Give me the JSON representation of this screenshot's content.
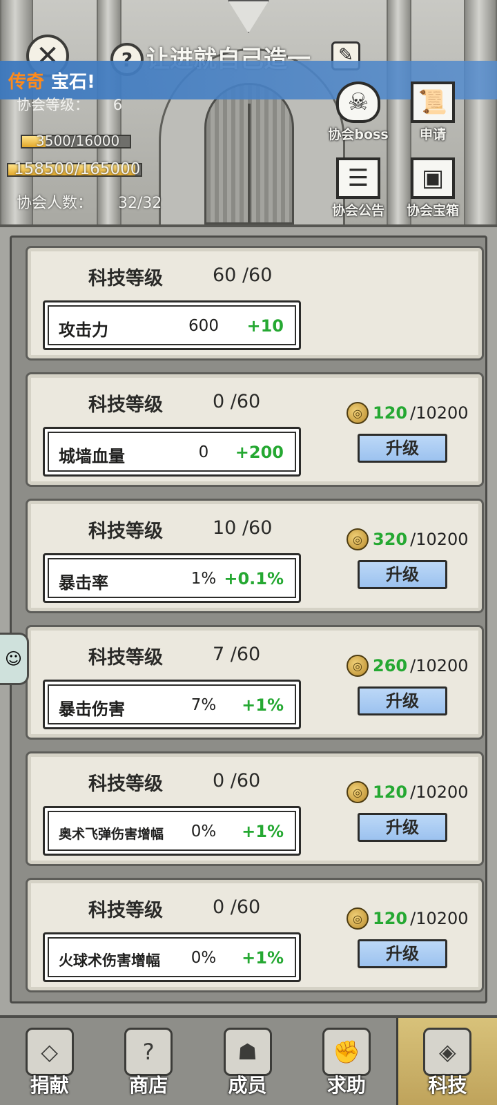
{
  "header": {
    "guild_name": "让进就自己造一",
    "banner": {
      "rarity": "传奇",
      "text": "宝石!"
    },
    "guild_level_label": "协会等级：",
    "guild_level_value": "6",
    "exp_bar": {
      "label": "3500/16000",
      "fraction": 0.22
    },
    "fund_bar": {
      "label": "158500/165000",
      "fraction": 0.96
    },
    "members_label": "协会人数：",
    "members_value": "32/32",
    "buttons": {
      "boss": "协会boss",
      "apply": "申请",
      "notice": "协会公告",
      "chest": "协会宝箱"
    }
  },
  "tech_level_label": "科技等级",
  "upgrade_label": "升级",
  "cards": [
    {
      "level": "60 /60",
      "stat": "攻击力",
      "current": "600",
      "increment": "+10",
      "cost_have": "",
      "cost_need": ""
    },
    {
      "level": "0 /60",
      "stat": "城墙血量",
      "current": "0",
      "increment": "+200",
      "cost_have": "120",
      "cost_need": "/10200"
    },
    {
      "level": "10 /60",
      "stat": "暴击率",
      "current": "1%",
      "increment": "+0.1%",
      "cost_have": "320",
      "cost_need": "/10200"
    },
    {
      "level": "7 /60",
      "stat": "暴击伤害",
      "current": "7%",
      "increment": "+1%",
      "cost_have": "260",
      "cost_need": "/10200"
    },
    {
      "level": "0 /60",
      "stat": "奥术飞弹伤害增幅",
      "current": "0%",
      "increment": "+1%",
      "cost_have": "120",
      "cost_need": "/10200"
    },
    {
      "level": "0 /60",
      "stat": "火球术伤害增幅",
      "current": "0%",
      "increment": "+1%",
      "cost_have": "120",
      "cost_need": "/10200"
    }
  ],
  "nav": {
    "donate": "捐献",
    "shop": "商店",
    "members": "成员",
    "help": "求助",
    "tech": "科技"
  },
  "icons": {
    "close": "close-icon",
    "help": "question-icon",
    "edit": "pencil-icon",
    "coin": "coin-icon"
  },
  "colors": {
    "increment_green": "#25a832",
    "banner_blue": "#3c78be",
    "rarity_orange": "#ff8a1a",
    "upgrade_button": "#9cc2ef"
  }
}
